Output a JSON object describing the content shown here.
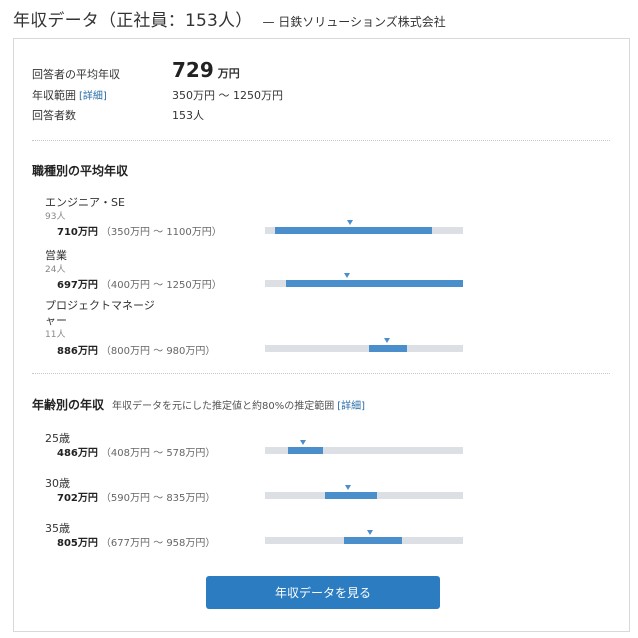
{
  "header": {
    "title": "年収データ（正社員：153人）",
    "company": "— 日鉄ソリューションズ株式会社"
  },
  "summary": {
    "avg_label": "回答者の平均年収",
    "avg_value": "729",
    "avg_unit": "万円",
    "range_label": "年収範囲",
    "range_link": "[詳細]",
    "range_value": "350万円 ～ 1250万円",
    "respondents_label": "回答者数",
    "respondents_value": "153人"
  },
  "by_job": {
    "title": "職種別の平均年収",
    "items": [
      {
        "name": "エンジニア・SE",
        "name2": "",
        "count": "93人",
        "avg": "710万円",
        "range": "（350万円 ～ 1100万円）",
        "min": 350,
        "max": 1100,
        "value": 710
      },
      {
        "name": "営業",
        "name2": "",
        "count": "24人",
        "avg": "697万円",
        "range": "（400万円 ～ 1250万円）",
        "min": 400,
        "max": 1250,
        "value": 697
      },
      {
        "name": "プロジェクトマネージ",
        "name2": "ャー",
        "count": "11人",
        "avg": "886万円",
        "range": "（800万円 ～ 980万円）",
        "min": 800,
        "max": 980,
        "value": 886
      }
    ]
  },
  "by_age": {
    "title": "年齢別の年収",
    "note": "年収データを元にした推定値と約80%の推定範囲",
    "note_link": "[詳細]",
    "items": [
      {
        "age": "25歳",
        "avg": "486万円",
        "range": "（408万円 ～ 578万円）",
        "min": 408,
        "max": 578,
        "value": 486
      },
      {
        "age": "30歳",
        "avg": "702万円",
        "range": "（590万円 ～ 835万円）",
        "min": 590,
        "max": 835,
        "value": 702
      },
      {
        "age": "35歳",
        "avg": "805万円",
        "range": "（677万円 ～ 958万円）",
        "min": 677,
        "max": 958,
        "value": 805
      }
    ]
  },
  "cta_label": "年収データを見る",
  "scale": {
    "min": 300,
    "max": 1250
  }
}
